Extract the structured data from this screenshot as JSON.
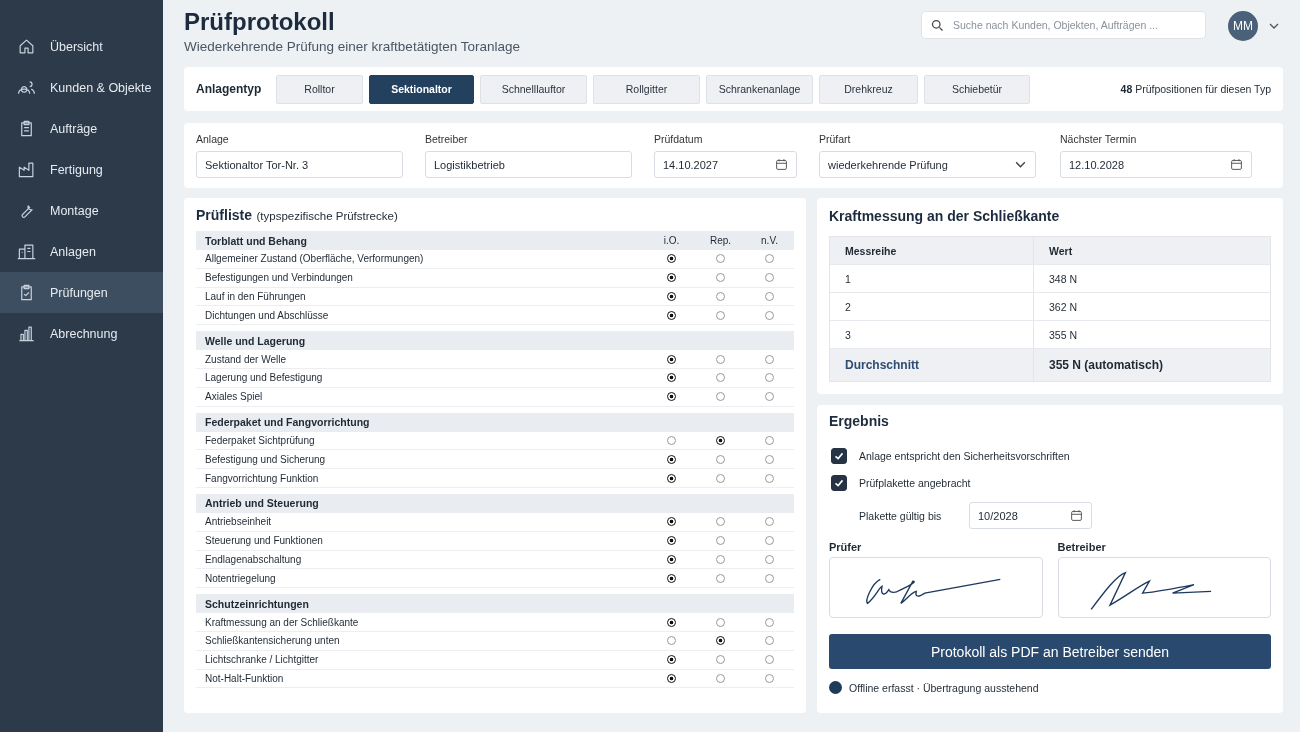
{
  "sidebar": {
    "items": [
      {
        "label": "Übersicht",
        "selected": false
      },
      {
        "label": "Kunden & Objekte",
        "selected": false
      },
      {
        "label": "Aufträge",
        "selected": false
      },
      {
        "label": "Fertigung",
        "selected": false
      },
      {
        "label": "Montage",
        "selected": false
      },
      {
        "label": "Anlagen",
        "selected": false
      },
      {
        "label": "Prüfungen",
        "selected": true
      },
      {
        "label": "Abrechnung",
        "selected": false
      }
    ]
  },
  "header": {
    "title": "Prüfprotokoll",
    "subtitle": "Wiederkehrende Prüfung einer kraftbetätigten Toranlage",
    "search": {
      "placeholder": "Suche nach Kunden, Objekten, Aufträgen ..."
    },
    "avatar": "MM"
  },
  "type_bar": {
    "label": "Anlagentyp",
    "types": [
      {
        "label": "Rolltor",
        "selected": false
      },
      {
        "label": "Sektionaltor",
        "selected": true
      },
      {
        "label": "Schnelllauftor",
        "selected": false
      },
      {
        "label": "Rollgitter",
        "selected": false
      },
      {
        "label": "Schrankenanlage",
        "selected": false
      },
      {
        "label": "Drehkreuz",
        "selected": false
      },
      {
        "label": "Schiebetür",
        "selected": false
      }
    ],
    "count_note": "**48** Prüfpositionen für diesen Typ"
  },
  "fields": [
    {
      "kind": "text",
      "label": "Anlage",
      "value": "Sektionaltor Tor-Nr. 3"
    },
    {
      "kind": "text",
      "label": "Betreiber",
      "value": "Logistikbetrieb"
    },
    {
      "kind": "date",
      "label": "Prüfdatum",
      "value": "14.10.2027"
    },
    {
      "kind": "select",
      "label": "Prüfart",
      "value": "wiederkehrende Prüfung"
    },
    {
      "kind": "date",
      "label": "Nächster Termin",
      "value": "12.10.2028"
    }
  ],
  "checklist": {
    "title": "Prüfliste",
    "title_note": "(typspezifische Prüfstrecke)",
    "columns": [
      "i.O.",
      "Rep.",
      "n.V."
    ],
    "groups": [
      {
        "title": "Torblatt und Behang",
        "items": [
          {
            "label": "Allgemeiner Zustand (Oberfläche, Verformungen)",
            "marks": [
              true,
              false,
              false
            ]
          },
          {
            "label": "Befestigungen und Verbindungen",
            "marks": [
              true,
              false,
              false
            ]
          },
          {
            "label": "Lauf in den Führungen",
            "marks": [
              true,
              false,
              false
            ]
          },
          {
            "label": "Dichtungen und Abschlüsse",
            "marks": [
              true,
              false,
              false
            ]
          }
        ]
      },
      {
        "title": "Welle und Lagerung",
        "items": [
          {
            "label": "Zustand der Welle",
            "marks": [
              true,
              false,
              false
            ]
          },
          {
            "label": "Lagerung und Befestigung",
            "marks": [
              true,
              false,
              false
            ]
          },
          {
            "label": "Axiales Spiel",
            "marks": [
              true,
              false,
              false
            ]
          }
        ]
      },
      {
        "title": "Federpaket und Fangvorrichtung",
        "items": [
          {
            "label": "Federpaket Sichtprüfung",
            "marks": [
              false,
              true,
              false
            ]
          },
          {
            "label": "Befestigung und Sicherung",
            "marks": [
              true,
              false,
              false
            ]
          },
          {
            "label": "Fangvorrichtung Funktion",
            "marks": [
              true,
              false,
              false
            ]
          }
        ]
      },
      {
        "title": "Antrieb und Steuerung",
        "items": [
          {
            "label": "Antriebseinheit",
            "marks": [
              true,
              false,
              false
            ]
          },
          {
            "label": "Steuerung und Funktionen",
            "marks": [
              true,
              false,
              false
            ]
          },
          {
            "label": "Endlagenabschaltung",
            "marks": [
              true,
              false,
              false
            ]
          },
          {
            "label": "Notentriegelung",
            "marks": [
              true,
              false,
              false
            ]
          }
        ]
      },
      {
        "title": "Schutzeinrichtungen",
        "items": [
          {
            "label": "Kraftmessung an der Schließkante",
            "marks": [
              true,
              false,
              false
            ]
          },
          {
            "label": "Schließkantensicherung unten",
            "marks": [
              false,
              true,
              false
            ]
          },
          {
            "label": "Lichtschranke / Lichtgitter",
            "marks": [
              true,
              false,
              false
            ]
          },
          {
            "label": "Not-Halt-Funktion",
            "marks": [
              true,
              false,
              false
            ]
          }
        ]
      }
    ]
  },
  "force": {
    "title": "Kraftmessung an der Schließkante",
    "columns": [
      "Messreihe",
      "Wert"
    ],
    "rows": [
      [
        "1",
        "348 N"
      ],
      [
        "2",
        "362 N"
      ],
      [
        "3",
        "355 N"
      ]
    ],
    "average": {
      "label": "Durchschnitt",
      "value": "355 N (automatisch)"
    }
  },
  "result": {
    "title": "Ergebnis",
    "checks": [
      {
        "label": "Anlage entspricht den Sicherheitsvorschriften",
        "checked": true
      },
      {
        "label": "Prüfplakette angebracht",
        "checked": true
      }
    ],
    "valid_until": {
      "label": "Plakette gültig bis",
      "value": "10/2028"
    },
    "signatures": [
      {
        "label": "Prüfer"
      },
      {
        "label": "Betreiber"
      }
    ],
    "send_button": "Protokoll als PDF an Betreiber senden",
    "status": {
      "text": "Offline erfasst · Übertragung ausstehend",
      "color": "#1f3b5c"
    }
  }
}
